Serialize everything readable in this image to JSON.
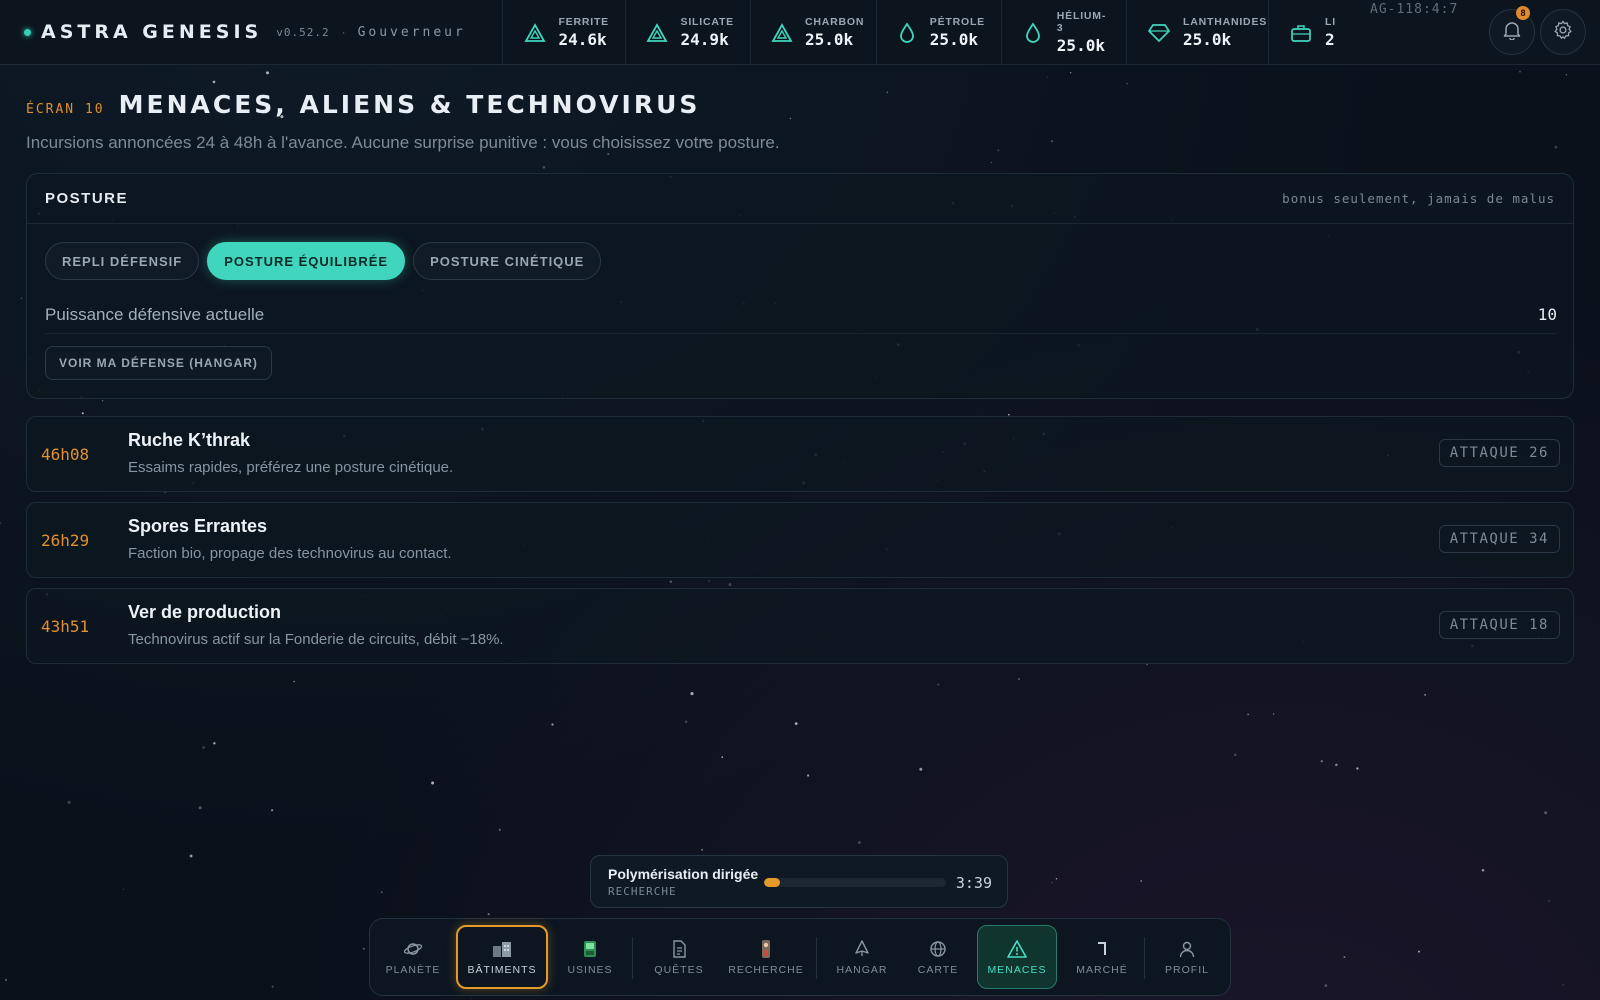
{
  "app": {
    "name": "ASTRA GENESIS",
    "version": "v0.52.2",
    "separator": "·",
    "role": "Gouverneur"
  },
  "resources": [
    {
      "label": "FERRITE",
      "value": "24.6k",
      "icon": "triangle-mineral-icon"
    },
    {
      "label": "SILICATE",
      "value": "24.9k",
      "icon": "triangle-mineral-icon"
    },
    {
      "label": "CHARBON",
      "value": "25.0k",
      "icon": "triangle-mineral-icon"
    },
    {
      "label": "PÉTROLE",
      "value": "25.0k",
      "icon": "drop-icon"
    },
    {
      "label": "HÉLIUM-3",
      "value": "25.0k",
      "icon": "drop-icon"
    },
    {
      "label": "LANTHANIDES",
      "value": "25.0k",
      "icon": "gem-icon"
    },
    {
      "label": "LI",
      "value": "2",
      "icon": "briefcase-icon"
    }
  ],
  "server_code": "AG-118:4:7",
  "notifications": {
    "count": "8"
  },
  "screen": {
    "number": "ÉCRAN 10",
    "title": "MENACES, ALIENS & TECHNOVIRUS",
    "subtitle": "Incursions annoncées 24 à 48h à l'avance. Aucune surprise punitive : vous choisissez votre posture."
  },
  "posture": {
    "title": "POSTURE",
    "note": "bonus seulement, jamais de malus",
    "options": [
      "REPLI DÉFENSIF",
      "POSTURE ÉQUILIBRÉE",
      "POSTURE CINÉTIQUE"
    ],
    "selected": "POSTURE ÉQUILIBRÉE",
    "power_label": "Puissance défensive actuelle",
    "power_value": "10",
    "defense_button": "VOIR MA DÉFENSE (HANGAR)"
  },
  "threats": [
    {
      "eta": "46h08",
      "name": "Ruche K’thrak",
      "desc": "Essaims rapides, préférez une posture cinétique.",
      "attack": "ATTAQUE 26"
    },
    {
      "eta": "26h29",
      "name": "Spores Errantes",
      "desc": "Faction bio, propage des technovirus au contact.",
      "attack": "ATTAQUE 34"
    },
    {
      "eta": "43h51",
      "name": "Ver de production",
      "desc": "Technovirus actif sur la Fonderie de circuits, débit −18%.",
      "attack": "ATTAQUE 18"
    }
  ],
  "research_toast": {
    "title": "Polymérisation dirigée",
    "subtitle": "RECHERCHE",
    "time": "3:39",
    "progress": 0.09
  },
  "nav": [
    {
      "label": "PLANÈTE",
      "icon": "planet-icon"
    },
    {
      "label": "BÂTIMENTS",
      "icon": "building-icon"
    },
    {
      "label": "USINES",
      "icon": "factory-icon"
    },
    {
      "label": "QUÊTES",
      "icon": "document-icon"
    },
    {
      "label": "RECHERCHE",
      "icon": "flask-icon"
    },
    {
      "label": "HANGAR",
      "icon": "ship-icon"
    },
    {
      "label": "CARTE",
      "icon": "globe-icon"
    },
    {
      "label": "MENACES",
      "icon": "warning-icon"
    },
    {
      "label": "MARCHÉ",
      "icon": "market-icon"
    },
    {
      "label": "PROFIL",
      "icon": "user-icon"
    }
  ],
  "nav_active": "MENACES",
  "colors": {
    "accent": "#3fd6bd",
    "warning": "#e0902e",
    "background": "#0a111b"
  }
}
